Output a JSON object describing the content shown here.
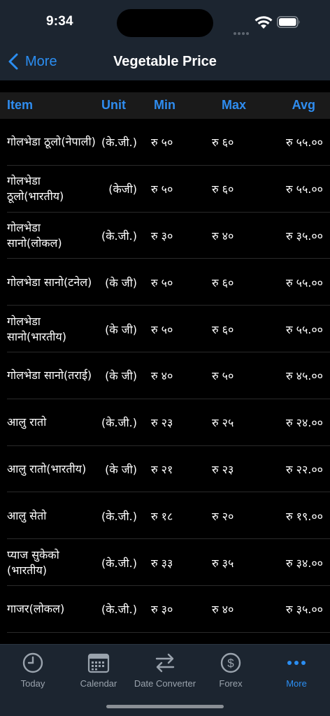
{
  "status": {
    "time": "9:34"
  },
  "nav": {
    "back_label": "More",
    "title": "Vegetable Price"
  },
  "table": {
    "headers": {
      "item": "Item",
      "unit": "Unit",
      "min": "Min",
      "max": "Max",
      "avg": "Avg"
    },
    "rows": [
      {
        "item": "गोलभेडा ठूलो(नेपाली)",
        "unit": "(के.जी.)",
        "min": "रु ५०",
        "max": "रु ६०",
        "avg": "रु ५५.००"
      },
      {
        "item": "गोलभेडा ठूलो(भारतीय)",
        "unit": "(केजी)",
        "min": "रु ५०",
        "max": "रु ६०",
        "avg": "रु ५५.००"
      },
      {
        "item": "गोलभेडा सानो(लोकल)",
        "unit": "(के.जी.)",
        "min": "रु ३०",
        "max": "रु ४०",
        "avg": "रु ३५.००"
      },
      {
        "item": "गोलभेडा सानो(टनेल)",
        "unit": "(के जी)",
        "min": "रु ५०",
        "max": "रु ६०",
        "avg": "रु ५५.००"
      },
      {
        "item": "गोलभेडा सानो(भारतीय)",
        "unit": "(के जी)",
        "min": "रु ५०",
        "max": "रु ६०",
        "avg": "रु ५५.००"
      },
      {
        "item": "गोलभेडा सानो(तराई)",
        "unit": "(के जी)",
        "min": "रु ४०",
        "max": "रु ५०",
        "avg": "रु ४५.००"
      },
      {
        "item": "आलु रातो",
        "unit": "(के.जी.)",
        "min": "रु २३",
        "max": "रु २५",
        "avg": "रु २४.००"
      },
      {
        "item": "आलु रातो(भारतीय)",
        "unit": "(के जी)",
        "min": "रु २१",
        "max": "रु २३",
        "avg": "रु २२.००"
      },
      {
        "item": "आलु सेतो",
        "unit": "(के.जी.)",
        "min": "रु १८",
        "max": "रु २०",
        "avg": "रु १९.००"
      },
      {
        "item": "प्याज सुकेको (भारतीय)",
        "unit": "(के.जी.)",
        "min": "रु ३३",
        "max": "रु ३५",
        "avg": "रु ३४.००"
      },
      {
        "item": "गाजर(लोकल)",
        "unit": "(के.जी.)",
        "min": "रु ३०",
        "max": "रु ४०",
        "avg": "रु ३५.००"
      }
    ]
  },
  "tabbar": {
    "tabs": [
      {
        "label": "Today",
        "icon": "clock-icon",
        "active": false
      },
      {
        "label": "Calendar",
        "icon": "calendar-icon",
        "active": false
      },
      {
        "label": "Date Converter",
        "icon": "swap-arrows-icon",
        "active": false
      },
      {
        "label": "Forex",
        "icon": "dollar-coin-icon",
        "active": false
      },
      {
        "label": "More",
        "icon": "ellipsis-icon",
        "active": true
      }
    ]
  },
  "colors": {
    "accent": "#2b8ef2",
    "bar_bg": "#1c2530",
    "inactive": "#9aa3ad"
  }
}
